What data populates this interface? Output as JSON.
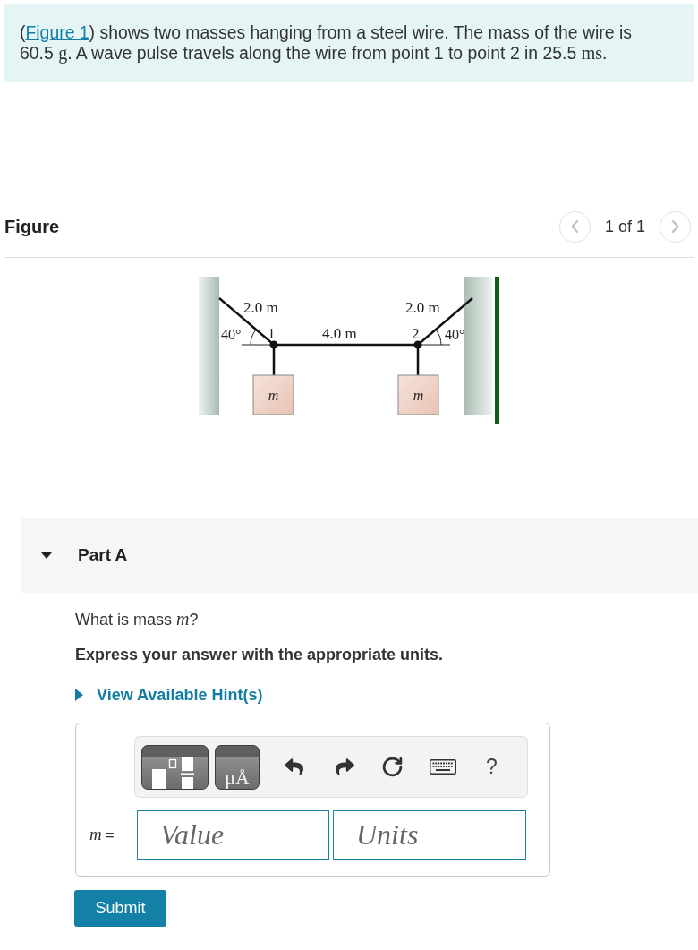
{
  "problem": {
    "segments": [
      {
        "kind": "text",
        "text": "("
      },
      {
        "kind": "link",
        "text": "Figure 1"
      },
      {
        "kind": "text",
        "text": ") shows two masses hanging from a steel wire. The mass of the wire is 60.5 "
      },
      {
        "kind": "unit",
        "text": "g"
      },
      {
        "kind": "text",
        "text": ". A wave pulse travels along the wire from point 1 to point 2 in 25.5 "
      },
      {
        "kind": "unit",
        "text": "ms"
      },
      {
        "kind": "text",
        "text": "."
      }
    ]
  },
  "figure_panel": {
    "title": "Figure",
    "pager": {
      "previous": {
        "disabled": true
      },
      "position": "1 of 1",
      "next": {
        "disabled": true
      }
    },
    "diagram": {
      "left_length": "2.0 m",
      "left_angle": "40°",
      "point_1": "1",
      "middle_length": "4.0 m",
      "point_2": "2",
      "right_length": "2.0 m",
      "right_angle": "40°",
      "masses": [
        {
          "label": "m"
        },
        {
          "label": "m"
        }
      ]
    }
  },
  "part": {
    "title": "Part A",
    "expanded": true
  },
  "question": {
    "segments": [
      {
        "kind": "text",
        "text": "What is mass "
      },
      {
        "kind": "var",
        "text": "m"
      },
      {
        "kind": "text",
        "text": "?"
      }
    ]
  },
  "instruction": "Express your answer with the appropriate units.",
  "hints": {
    "label": "View Available Hint(s)",
    "expanded": false
  },
  "answer": {
    "toolbar": [
      {
        "kind": "templates"
      },
      {
        "kind": "units",
        "label": "μÅ"
      },
      {
        "kind": "undo"
      },
      {
        "kind": "redo"
      },
      {
        "kind": "reset"
      },
      {
        "kind": "keyboard"
      },
      {
        "kind": "help",
        "label": "?"
      }
    ],
    "variable": [
      {
        "kind": "var",
        "text": "m"
      },
      {
        "kind": "text",
        "text": " ="
      }
    ],
    "value": {
      "placeholder": "Value"
    },
    "units": {
      "placeholder": "Units"
    }
  },
  "submit": {
    "label": "Submit"
  }
}
